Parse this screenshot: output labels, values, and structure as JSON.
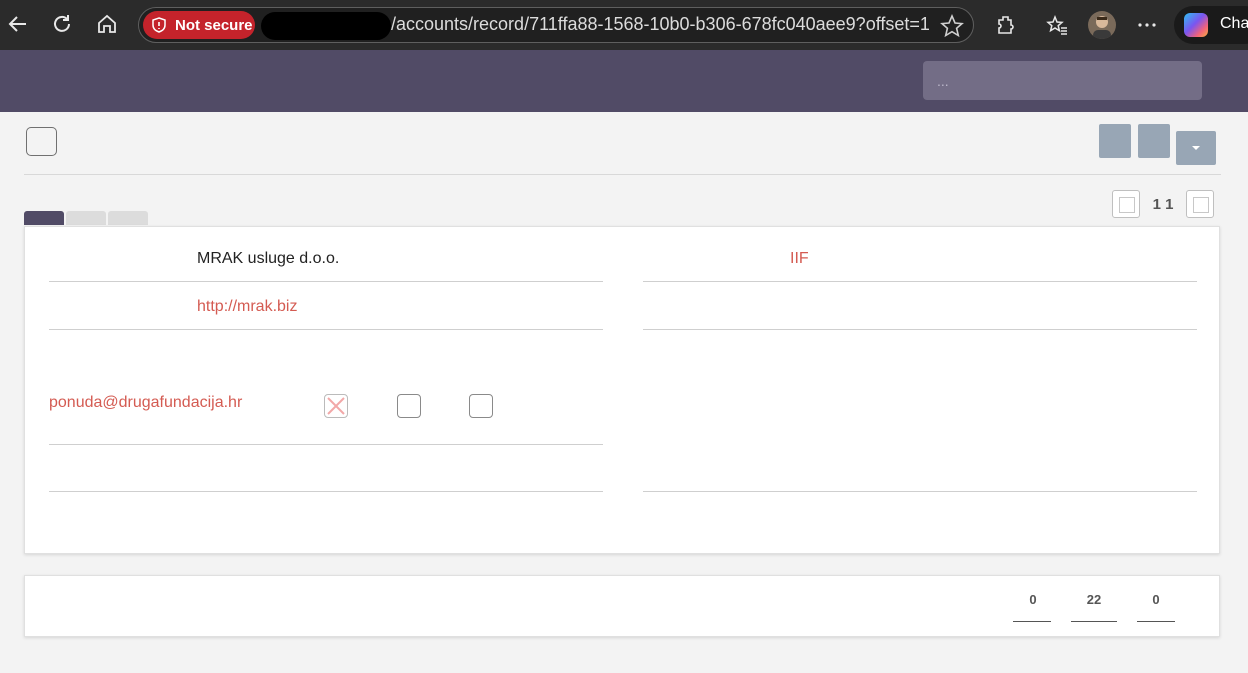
{
  "browser": {
    "security_label": "Not secure",
    "url": "/accounts/record/711ffa88-1568-10b0-b306-678fc040aee9?offset=1",
    "copilot_label": "Chat"
  },
  "header": {
    "search_placeholder": "..."
  },
  "pager": {
    "position": "1 1"
  },
  "record": {
    "name": "MRAK usluge d.o.o.",
    "website": "http://mrak.biz",
    "email": "ponuda@drugafundacija.hr",
    "right_value": "IIF"
  },
  "counts": {
    "first": "0",
    "second": "22",
    "third": "0"
  },
  "colors": {
    "header_bg": "#514b66",
    "accent_red": "#d45b52",
    "button_gray": "#98a6b5"
  }
}
